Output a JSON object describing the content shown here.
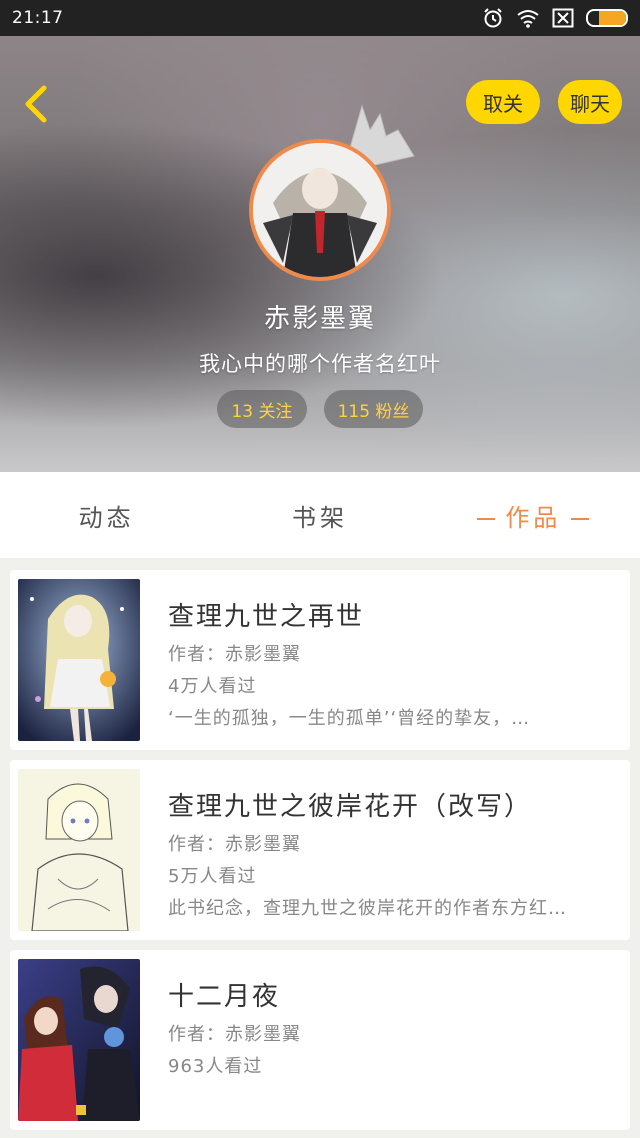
{
  "status_bar": {
    "time": "21:17",
    "icons": [
      "alarm-icon",
      "wifi-icon",
      "close-box-icon",
      "battery-icon"
    ],
    "battery_level": 0.7
  },
  "header": {
    "back_icon": "chevron-left-icon",
    "unfollow_label": "取关",
    "chat_label": "聊天",
    "username": "赤影墨翼",
    "bio": "我心中的哪个作者名红叶",
    "follow_count": "13 关注",
    "fans_count": "115 粉丝",
    "accent_color": "#ffd700",
    "avatar_ring_color": "#f08a4b"
  },
  "tabs": [
    {
      "label": "动态",
      "active": false
    },
    {
      "label": "书架",
      "active": false
    },
    {
      "label": "作品",
      "active": true
    }
  ],
  "works": [
    {
      "title": "查理九世之再世",
      "author": "作者：赤影墨翼",
      "views": "4万人看过",
      "desc": "‘一生的孤独，一生的孤单’‘曾经的挚友，…"
    },
    {
      "title": "查理九世之彼岸花开（改写）",
      "author": "作者：赤影墨翼",
      "views": "5万人看过",
      "desc": "此书纪念，查理九世之彼岸花开的作者东方红…"
    },
    {
      "title": "十二月夜",
      "author": "作者：赤影墨翼",
      "views": "963人看过",
      "desc": ""
    }
  ]
}
